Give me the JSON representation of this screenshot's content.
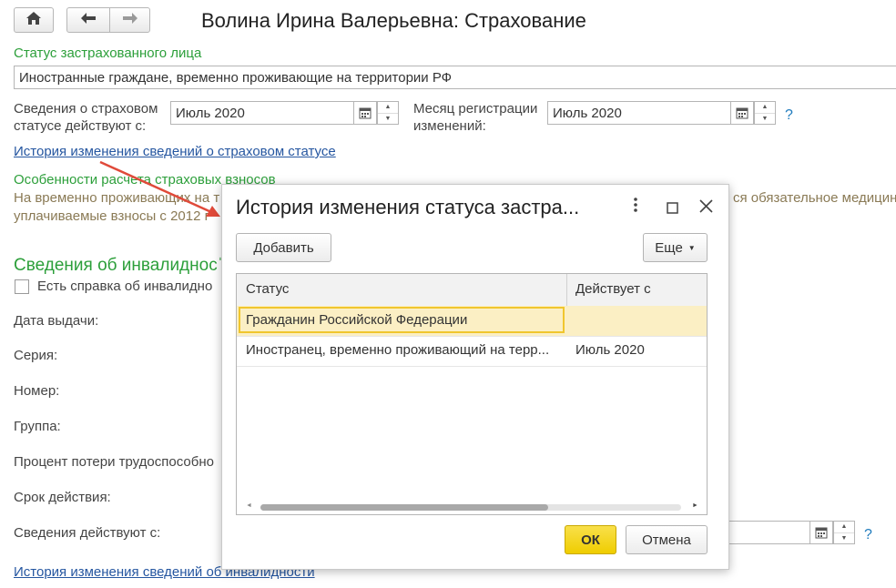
{
  "window": {
    "title": "Волина Ирина Валерьевна: Страхование"
  },
  "toolbar": {
    "home_icon": "home-icon",
    "back_icon": "arrow-left-icon",
    "forward_icon": "arrow-right-icon"
  },
  "form": {
    "insured_status_label": "Статус застрахованного лица",
    "insured_status_value": "Иностранные граждане, временно проживающие на территории РФ",
    "status_valid_from_label_1": "Сведения о страховом",
    "status_valid_from_label_2": "статусе действуют с:",
    "status_valid_from_value": "Июль 2020",
    "reg_month_label_1": "Месяц регистрации",
    "reg_month_label_2": "изменений:",
    "reg_month_value": "Июль 2020",
    "help_mark": "?",
    "history_link": "История изменения сведений о страховом статусе",
    "calc_features_title": "Особенности расчета страховых взносов",
    "calc_note_line1_left": "На временно проживающих на т",
    "calc_note_line1_right": "ся обязательное медицин",
    "calc_note_line2_left": "уплачиваемые взносы с 2012 г",
    "disability_title": "Сведения об инвалидносˈ",
    "disability_check_label": "Есть справка об инвалидно",
    "issue_date_label": "Дата выдачи:",
    "series_label": "Серия:",
    "number_label": "Номер:",
    "group_label": "Группа:",
    "percent_label": "Процент потери трудоспособно",
    "validity_label": "Срок действия:",
    "data_valid_label": "Сведения действуют с:",
    "disability_history_link": "История изменения сведений об инвалидности"
  },
  "dialog": {
    "title": "История изменения статуса застра...",
    "add_button": "Добавить",
    "more_button": "Еще",
    "columns": [
      "Статус",
      "Действует с"
    ],
    "rows": [
      {
        "status": "Гражданин Российской Федерации",
        "from": ""
      },
      {
        "status": "Иностранец, временно проживающий на терр...",
        "from": "Июль 2020"
      }
    ],
    "ok_button": "ОК",
    "cancel_button": "Отмена"
  },
  "colors": {
    "accent_green": "#2c9f3a",
    "link_blue": "#2556a0",
    "selected_row": "#fbefc4",
    "ok_yellow": "#f5d90a",
    "arrow_red": "#e04a3a"
  }
}
